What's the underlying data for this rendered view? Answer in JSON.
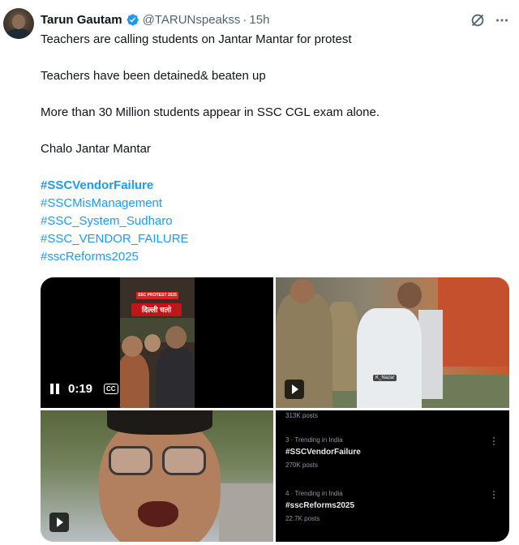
{
  "author": {
    "name": "Tarun Gautam",
    "handle": "@TARUNspeakss",
    "separator": "·",
    "time": "15h"
  },
  "tweet": {
    "lines": [
      "Teachers are calling students on Jantar Mantar for protest",
      "Teachers have been detained& beaten up",
      "More than 30 Million students appear in SSC CGL exam alone.",
      "Chalo Jantar Mantar"
    ],
    "hashtags": [
      "#SSCVendorFailure",
      "#SSCMisManagement",
      "#SSC_System_Sudharo",
      "#SSC_VENDOR_FAILURE",
      "#sscReforms2025"
    ]
  },
  "media": {
    "video": {
      "duration": "0:19",
      "cc_label": "CC",
      "banner_top": "SSC PROTEST 2025",
      "banner_main": "दिल्ली चलो"
    },
    "clip_watermark": "K_Nazar",
    "trending": {
      "top_count": "313K posts",
      "items": [
        {
          "meta": "3 · Trending in India",
          "tag": "#SSCVendorFailure",
          "count": "270K posts"
        },
        {
          "meta": "4 · Trending in India",
          "tag": "#sscReforms2025",
          "count": "22.7K posts"
        }
      ]
    }
  },
  "icons": {
    "verified": "verified-badge-icon",
    "grok": "grok-icon",
    "more": "more-options-icon",
    "pause": "pause-icon",
    "play": "play-icon",
    "captions": "captions-icon"
  },
  "colors": {
    "link": "#1d9bf0",
    "text": "#0f1419",
    "secondary": "#536471"
  }
}
